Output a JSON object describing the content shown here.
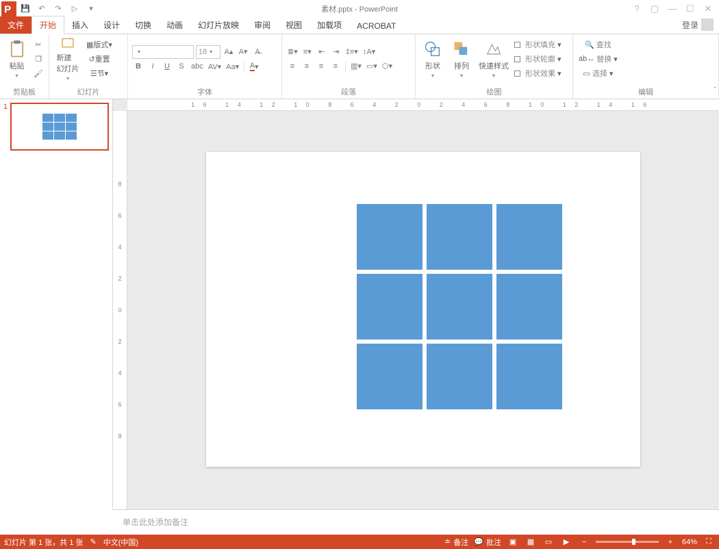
{
  "qat": {
    "save": "💾",
    "undo": "↶",
    "redo": "↷",
    "start": "▷",
    "more": "▾"
  },
  "title": "素材.pptx - PowerPoint",
  "winctl": {
    "help": "?",
    "ribmode": "▢",
    "min": "—",
    "max": "☐",
    "close": "✕"
  },
  "tabs": {
    "file": "文件",
    "home": "开始",
    "insert": "插入",
    "design": "设计",
    "transitions": "切换",
    "animations": "动画",
    "slideshow": "幻灯片放映",
    "review": "审阅",
    "view": "视图",
    "addins": "加载项",
    "acrobat": "ACROBAT",
    "login": "登录"
  },
  "ribbon": {
    "clipboard": {
      "label": "剪贴板",
      "paste": "粘贴"
    },
    "slides": {
      "label": "幻灯片",
      "new": "新建\n幻灯片",
      "layout": "版式",
      "reset": "重置",
      "section": "节"
    },
    "font": {
      "label": "字体",
      "font_name": "",
      "font_size": "18"
    },
    "para": {
      "label": "段落"
    },
    "draw": {
      "label": "绘图",
      "shapes": "形状",
      "arrange": "排列",
      "quick": "快速样式",
      "fill": "形状填充",
      "outline": "形状轮廓",
      "effects": "形状效果"
    },
    "edit": {
      "label": "编辑",
      "find": "查找",
      "replace": "替换",
      "select": "选择"
    }
  },
  "thumb": {
    "num": "1"
  },
  "ruler_h": "16    14    12    10    8     6     4     2     0     2     4     6     8     10    12    14    16",
  "ruler_v": [
    "8",
    "6",
    "4",
    "2",
    "0",
    "2",
    "4",
    "6",
    "8"
  ],
  "notes_placeholder": "单击此处添加备注",
  "status": {
    "slide": "幻灯片 第 1 张，共 1 张",
    "lang": "中文(中国)",
    "notes": "备注",
    "comments": "批注",
    "zoom": "64%"
  }
}
